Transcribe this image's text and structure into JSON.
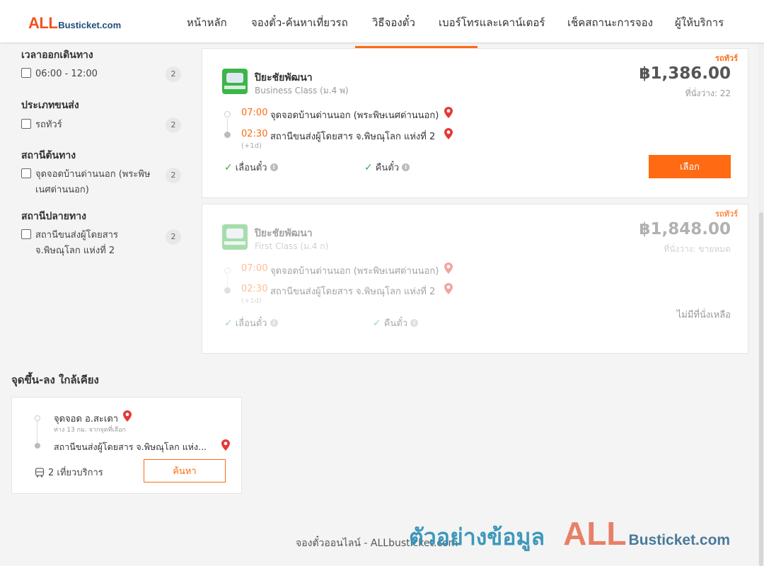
{
  "header": {
    "logo_all": "ALL",
    "logo_rest": "Busticket.com",
    "nav": [
      {
        "label": "หน้าหลัก"
      },
      {
        "label": "จองตั๋ว-ค้นหาเที่ยวรถ"
      },
      {
        "label": "วิธีจองตั๋ว",
        "active": true
      },
      {
        "label": "เบอร์โทรและเคาน์เตอร์"
      },
      {
        "label": "เช็คสถานะการจอง"
      },
      {
        "label": "ผู้ให้บริการ"
      }
    ],
    "accent_color": "#ff6a13"
  },
  "filters": {
    "departure_time": {
      "title": "เวลาออกเดินทาง",
      "options": [
        {
          "label": "06:00 - 12:00",
          "count": "2",
          "checked": false
        }
      ]
    },
    "transport_type": {
      "title": "ประเภทขนส่ง",
      "options": [
        {
          "label": "รถทัวร์",
          "count": "2",
          "checked": false
        }
      ]
    },
    "origin_station": {
      "title": "สถานีต้นทาง",
      "options": [
        {
          "label": "จุดจอดบ้านด่านนอก (พระพิษเนศด่านนอก)",
          "count": "2",
          "checked": false
        }
      ]
    },
    "destination_station": {
      "title": "สถานีปลายทาง",
      "options": [
        {
          "label": "สถานีขนส่งผู้โดยสาร จ.พิษณุโลก แห่งที่ 2",
          "count": "2",
          "checked": false
        }
      ]
    }
  },
  "results": [
    {
      "tag": "รถทัวร์",
      "operator": "ปิยะชัยพัฒนา",
      "bus_class": "Business Class (ม.4 พ)",
      "price": "฿1,386.00",
      "seats": "ที่นั่งว่าง: 22",
      "depart_time": "07:00",
      "depart_stop": "จุดจอดบ้านด่านนอก (พระพิษเนศด่านนอก)",
      "arrive_time": "02:30",
      "arrive_stop": "สถานีขนส่งผู้โดยสาร จ.พิษณุโลก แห่งที่ 2",
      "next_day": "(+1d)",
      "feature_1": "เลื่อนตั๋ว",
      "feature_2": "คืนตั๋ว",
      "action": "เลือก",
      "available": true
    },
    {
      "tag": "รถทัวร์",
      "operator": "ปิยะชัยพัฒนา",
      "bus_class": "First Class (ม.4 ก)",
      "price": "฿1,848.00",
      "seats": "ที่นั่งว่าง: ขายหมด",
      "depart_time": "07:00",
      "depart_stop": "จุดจอดบ้านด่านนอก (พระพิษเนศด่านนอก)",
      "arrive_time": "02:30",
      "arrive_stop": "สถานีขนส่งผู้โดยสาร จ.พิษณุโลก แห่งที่ 2",
      "next_day": "(+1d)",
      "feature_1": "เลื่อนตั๋ว",
      "feature_2": "คืนตั๋ว",
      "status": "ไม่มีที่นั่งเหลือ",
      "available": false
    }
  ],
  "nearby": {
    "title": "จุดขึ้น-ลง ใกล้เคียง",
    "from_stop": "จุดจอด อ.สะเดา",
    "from_distance": "ห่าง 13 กม. จากจุดที่เลือก",
    "to_stop": "สถานีขนส่งผู้โดยสาร จ.พิษณุโลก แห่ง...",
    "trips": "2 เที่ยวบริการ",
    "search_label": "ค้นหา"
  },
  "footer": {
    "text": "จองตั๋วออนไลน์ - ALLbusticket.com"
  },
  "watermark": {
    "thai": "ตัวอย่างข้อมูล",
    "all": "ALL",
    "rest": "Busticket.com"
  }
}
